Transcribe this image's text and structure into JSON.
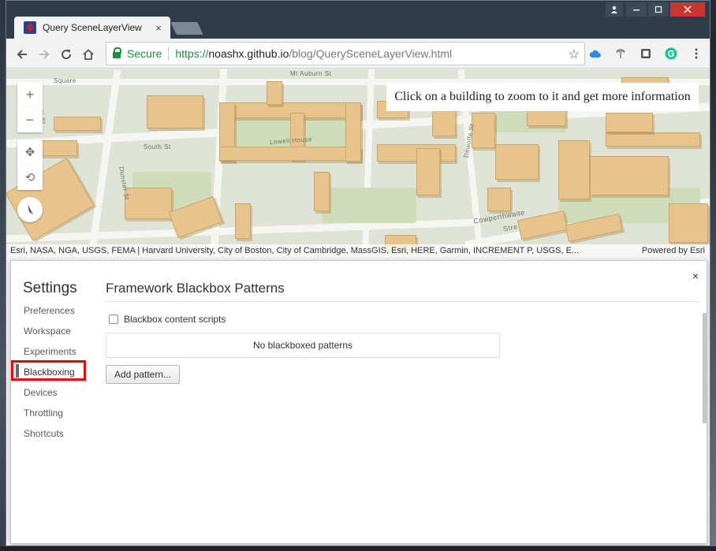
{
  "browser": {
    "tab_title": "Query SceneLayerView",
    "tab_close": "×",
    "omnibox": {
      "secure_label": "Secure",
      "url_scheme": "https://",
      "url_host": "noashx.github.io",
      "url_path": "/blog/QuerySceneLayerView.html"
    }
  },
  "map": {
    "info_text": "Click on a building to zoom to it and get more information",
    "attribution": "Esri, NASA, NGA, USGS, FEMA | Harvard University, City of Boston, City of Cambridge, MassGIS, Esri, HERE, Garmin, INCREMENT P, USGS, E...",
    "powered_by": "Powered by Esri",
    "streets": {
      "mt_auburn": "Mt Auburn St",
      "south": "South St",
      "lowell_house": "Lowell House",
      "dunster": "Dunster St",
      "dewolfe": "Dewolfe St",
      "cowperthwaite": "Cowperthwaite",
      "stre": "Stre",
      "square": "Square",
      "ds": "ds St"
    },
    "controls": {
      "zoom_in": "+",
      "zoom_out": "−",
      "pan": "✥",
      "rotate": "⟲"
    }
  },
  "devtools": {
    "close": "×",
    "settings_title": "Settings",
    "nav": [
      {
        "label": "Preferences"
      },
      {
        "label": "Workspace"
      },
      {
        "label": "Experiments"
      },
      {
        "label": "Blackboxing"
      },
      {
        "label": "Devices"
      },
      {
        "label": "Throttling"
      },
      {
        "label": "Shortcuts"
      }
    ],
    "selected_nav": "Blackboxing",
    "section_title": "Framework Blackbox Patterns",
    "checkbox_label": "Blackbox content scripts",
    "checkbox_checked": false,
    "patterns_empty": "No blackboxed patterns",
    "add_pattern_button": "Add pattern..."
  }
}
